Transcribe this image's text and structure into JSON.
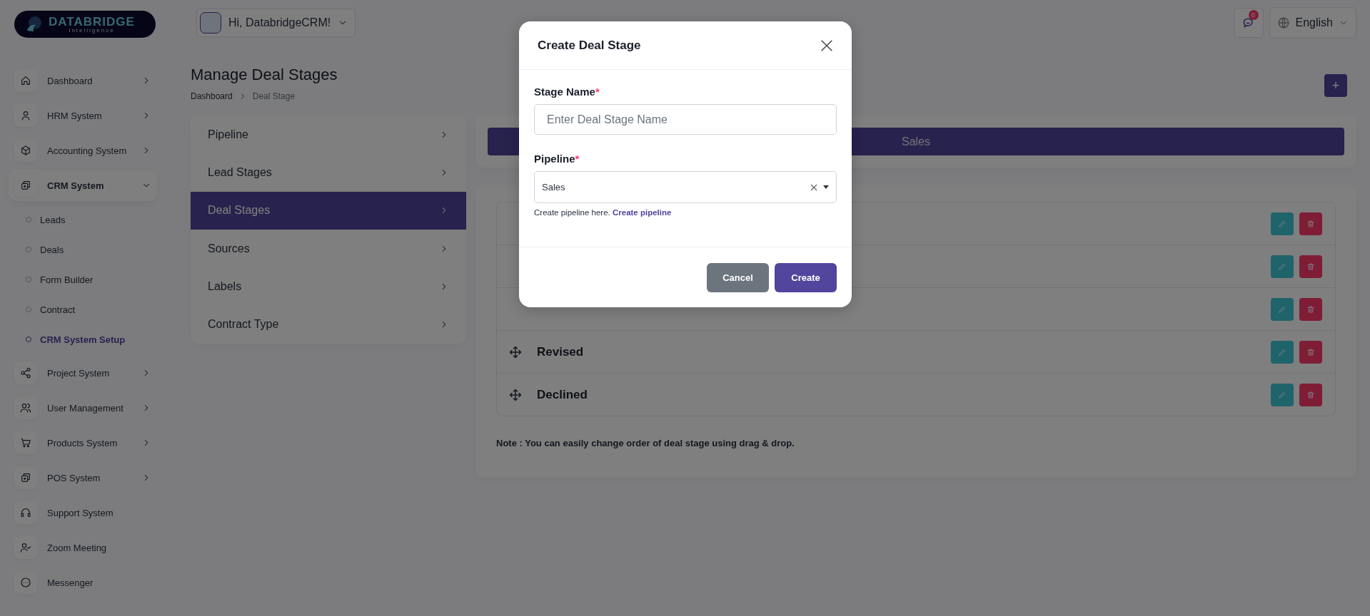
{
  "brand": {
    "name": "DATABRIDGE",
    "tagline": "Intelligence"
  },
  "user_menu": {
    "greeting": "Hi, DatabridgeCRM!"
  },
  "notifications": {
    "count": "0"
  },
  "language": {
    "label": "English"
  },
  "sidebar": {
    "items": [
      {
        "label": "Dashboard",
        "expandable": true,
        "expanded": false
      },
      {
        "label": "HRM System",
        "expandable": true,
        "expanded": false
      },
      {
        "label": "Accounting System",
        "expandable": true,
        "expanded": false
      },
      {
        "label": "CRM System",
        "expandable": true,
        "expanded": true,
        "children": [
          {
            "label": "Leads",
            "selected": false
          },
          {
            "label": "Deals",
            "selected": false
          },
          {
            "label": "Form Builder",
            "selected": false
          },
          {
            "label": "Contract",
            "selected": false
          },
          {
            "label": "CRM System Setup",
            "selected": true
          }
        ]
      },
      {
        "label": "Project System",
        "expandable": true,
        "expanded": false
      },
      {
        "label": "User Management",
        "expandable": true,
        "expanded": false
      },
      {
        "label": "Products System",
        "expandable": true,
        "expanded": false
      },
      {
        "label": "POS System",
        "expandable": true,
        "expanded": false
      },
      {
        "label": "Support System",
        "expandable": false,
        "expanded": false
      },
      {
        "label": "Zoom Meeting",
        "expandable": false,
        "expanded": false
      },
      {
        "label": "Messenger",
        "expandable": false,
        "expanded": false
      }
    ]
  },
  "page": {
    "title": "Manage Deal Stages",
    "breadcrumb": [
      "Dashboard",
      "Deal Stage"
    ],
    "add_button": "+"
  },
  "setup_menu": [
    {
      "label": "Pipeline",
      "selected": false
    },
    {
      "label": "Lead Stages",
      "selected": false
    },
    {
      "label": "Deal Stages",
      "selected": true
    },
    {
      "label": "Sources",
      "selected": false
    },
    {
      "label": "Labels",
      "selected": false
    },
    {
      "label": "Contract Type",
      "selected": false
    }
  ],
  "pipeline_tabs": [
    {
      "label": "Sales",
      "selected": true
    }
  ],
  "stages": [
    {
      "kind": "covered"
    },
    {
      "kind": "covered"
    },
    {
      "kind": "covered"
    },
    {
      "kind": "named",
      "name": "Revised"
    },
    {
      "kind": "named",
      "name": "Declined"
    }
  ],
  "note": "Note : You can easily change order of deal stage using drag & drop.",
  "modal": {
    "title": "Create Deal Stage",
    "stage_name": {
      "label": "Stage Name",
      "required_mark": "*",
      "placeholder": "Enter Deal Stage Name"
    },
    "pipeline": {
      "label": "Pipeline",
      "required_mark": "*",
      "value": "Sales",
      "help": "Create pipeline here.",
      "link": "Create pipeline"
    },
    "buttons": {
      "cancel": "Cancel",
      "create": "Create"
    }
  }
}
